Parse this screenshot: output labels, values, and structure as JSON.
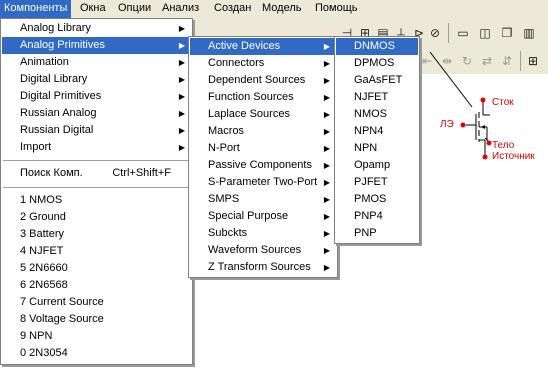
{
  "menubar": {
    "items": [
      "Компоненты",
      "Окна",
      "Опции",
      "Анализ",
      "Создан",
      "Модель",
      "Помощь"
    ]
  },
  "menu_components": {
    "items": [
      {
        "label": "Analog Library",
        "submenu": true
      },
      {
        "label": "Analog Primitives",
        "submenu": true
      },
      {
        "label": "Animation",
        "submenu": true
      },
      {
        "label": "Digital Library",
        "submenu": true
      },
      {
        "label": "Digital Primitives",
        "submenu": true
      },
      {
        "label": "Russian Analog",
        "submenu": true
      },
      {
        "label": "Russian Digital",
        "submenu": true
      },
      {
        "label": "Import",
        "submenu": true
      }
    ],
    "search_label": "Поиск Комп.",
    "search_shortcut": "Ctrl+Shift+F",
    "recent": [
      "1 NMOS",
      "2 Ground",
      "3 Battery",
      "4 NJFET",
      "5 2N6660",
      "6 2N6568",
      "7 Current Source",
      "8 Voltage Source",
      "9 NPN",
      "0 2N3054"
    ]
  },
  "menu_analog_primitives": {
    "items": [
      "Active Devices",
      "Connectors",
      "Dependent Sources",
      "Function Sources",
      "Laplace Sources",
      "Macros",
      "N-Port",
      "Passive Components",
      "S-Parameter Two-Port",
      "SMPS",
      "Special Purpose",
      "Subckts",
      "Waveform Sources",
      "Z Transform Sources"
    ]
  },
  "menu_active_devices": {
    "items": [
      "DNMOS",
      "DPMOS",
      "GaAsFET",
      "NJFET",
      "NMOS",
      "NPN4",
      "NPN",
      "Opamp",
      "PJFET",
      "PMOS",
      "PNP4",
      "PNP"
    ]
  },
  "schematic": {
    "label_drain": "Сток",
    "label_gate": "ЛЭ",
    "label_body": "Тело",
    "label_source": "Источник",
    "pin_color": "#e00000",
    "text_color": "#e00000"
  },
  "colors": {
    "highlight": "#316ac5",
    "menubar_bg": "#ece9d8"
  }
}
